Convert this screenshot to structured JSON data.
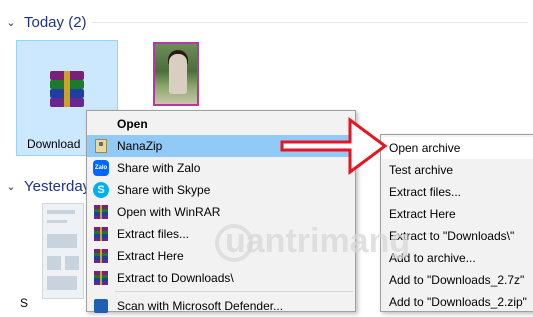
{
  "groups": {
    "today_label": "Today (2)",
    "yesterday_label": "Yesterday"
  },
  "files": {
    "downloads_label": "Download",
    "yesterday_label_fragment": "S"
  },
  "context_menu": {
    "items": [
      {
        "label": "Open",
        "icon": "none",
        "bold": true
      },
      {
        "label": "NanaZip",
        "icon": "nanazip-icon",
        "submenu": true
      },
      {
        "label": "Share with Zalo",
        "icon": "zalo-icon"
      },
      {
        "label": "Share with Skype",
        "icon": "skype-icon"
      },
      {
        "label": "Open with WinRAR",
        "icon": "winrar-icon"
      },
      {
        "label": "Extract files...",
        "icon": "winrar-icon"
      },
      {
        "label": "Extract Here",
        "icon": "winrar-icon"
      },
      {
        "label": "Extract to Downloads\\",
        "icon": "winrar-icon"
      },
      {
        "label": "Scan with Microsoft Defender...",
        "icon": "defender-icon"
      }
    ],
    "zalo_text": "Zalo",
    "skype_text": "S"
  },
  "submenu": {
    "items": [
      {
        "label": "Open archive"
      },
      {
        "label": "Test archive"
      },
      {
        "label": "Extract files..."
      },
      {
        "label": "Extract Here"
      },
      {
        "label": "Extract to \"Downloads\\\""
      },
      {
        "label": "Add to archive..."
      },
      {
        "label": "Add to \"Downloads_2.7z\""
      },
      {
        "label": "Add to \"Downloads_2.zip\""
      }
    ]
  },
  "annotation": {
    "color": "#e8141e"
  },
  "watermark": {
    "text": "uantrimang"
  },
  "colors": {
    "group_header": "#1e3287",
    "selection": "#cce8ff",
    "menu_highlight": "#91c9f7"
  }
}
